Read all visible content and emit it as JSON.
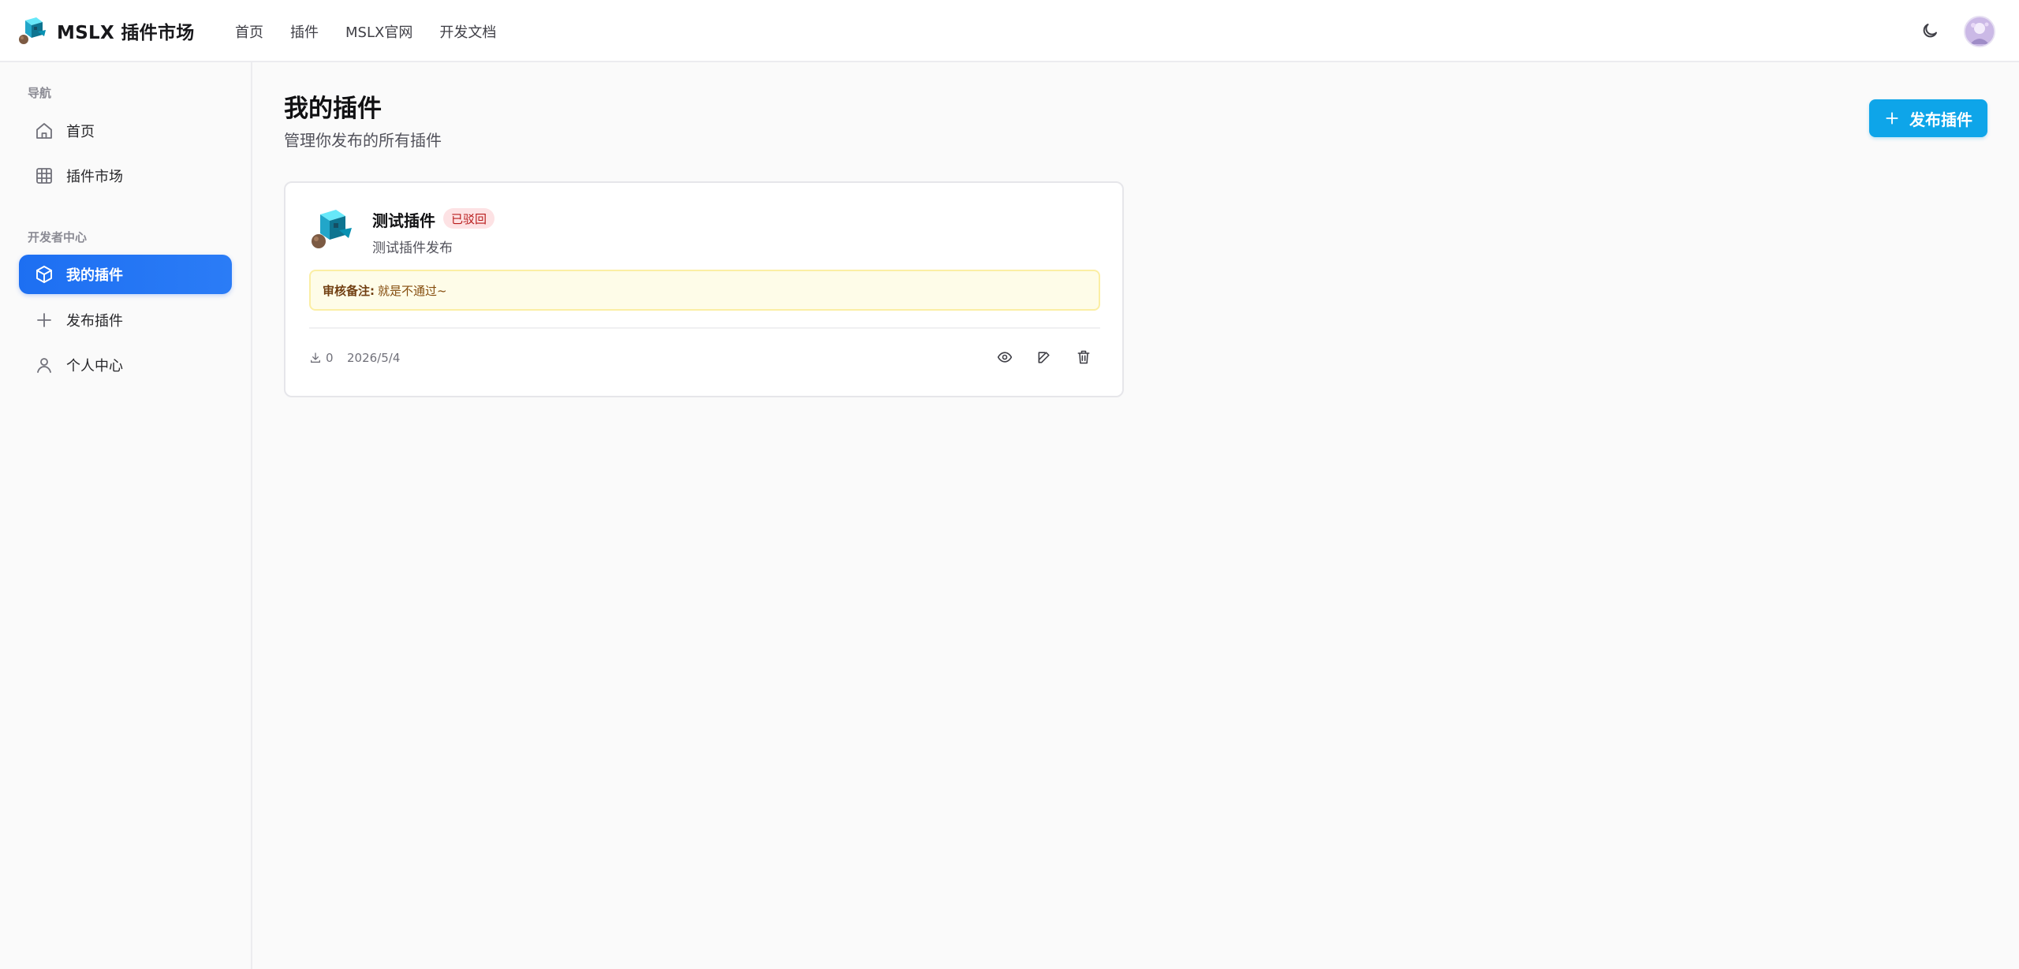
{
  "app": {
    "brand": "MSLX 插件市场",
    "logo_icon": "cube-creature-logo"
  },
  "topnav": {
    "items": [
      {
        "label": "首页"
      },
      {
        "label": "插件"
      },
      {
        "label": "MSLX官网"
      },
      {
        "label": "开发文档"
      }
    ]
  },
  "header_actions": {
    "theme_icon": "moon-icon",
    "avatar_icon": "user-avatar"
  },
  "sidebar": {
    "sections": [
      {
        "title": "导航",
        "items": [
          {
            "label": "首页",
            "icon": "home-icon",
            "active": false
          },
          {
            "label": "插件市场",
            "icon": "grid-icon",
            "active": false
          }
        ]
      },
      {
        "title": "开发者中心",
        "items": [
          {
            "label": "我的插件",
            "icon": "box-icon",
            "active": true
          },
          {
            "label": "发布插件",
            "icon": "plus-icon",
            "active": false
          },
          {
            "label": "个人中心",
            "icon": "user-icon",
            "active": false
          }
        ]
      }
    ]
  },
  "main": {
    "title": "我的插件",
    "subtitle": "管理你发布的所有插件",
    "publish_button": "发布插件"
  },
  "plugins": [
    {
      "name": "测试插件",
      "status": "已驳回",
      "description": "测试插件发布",
      "review_label": "审核备注:",
      "review_text": "就是不通过~",
      "downloads": "0",
      "date": "2026/5/4"
    }
  ],
  "colors": {
    "accent": "#0ea5e9",
    "active_nav": "#2563eb",
    "rejected_bg": "#fde2e4",
    "rejected_text": "#b91c1c",
    "note_bg": "#fefce8"
  }
}
